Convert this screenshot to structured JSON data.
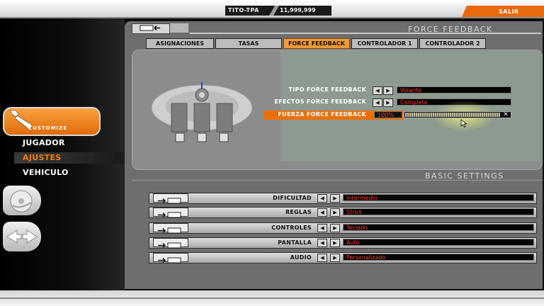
{
  "top_bar": {
    "player_name": "TITO-TPA",
    "money": "11,999,999",
    "exit_label": "SALIR"
  },
  "sidebar": {
    "customize_label": "CUSTOMIZE",
    "items": [
      {
        "label": "JUGADOR"
      },
      {
        "label": "AJUSTES",
        "active": true,
        "color": "#f07a10"
      },
      {
        "label": "VEHICULO"
      }
    ]
  },
  "panel": {
    "title": "FORCE FEEDBACK",
    "tabs": [
      {
        "label": "ASIGNACIONES"
      },
      {
        "label": "TASAS"
      },
      {
        "label": "FORCE FEEDBACK",
        "active": true
      },
      {
        "label": "CONTROLADOR 1"
      },
      {
        "label": "CONTROLADOR 2"
      }
    ]
  },
  "force_feedback": {
    "settings": [
      {
        "label": "TIPO FORCE FEEDBACK",
        "value": "Volante"
      },
      {
        "label": "EFECTOS FORCE FEEDBACK",
        "value": "Completo"
      },
      {
        "label": "FUERZA FORCE FEEDBACK",
        "value": "100%",
        "level": 1.0
      }
    ]
  },
  "basic_settings": {
    "title": "BASIC SETTINGS",
    "rows": [
      {
        "label": "DIFICULTAD",
        "value": "Intermedio"
      },
      {
        "label": "REGLAS",
        "value": "Strict"
      },
      {
        "label": "CONTROLES",
        "value": "Teclado"
      },
      {
        "label": "PANTALLA",
        "value": "Auto"
      },
      {
        "label": "AUDIO",
        "value": "Personalizado"
      }
    ]
  },
  "colors": {
    "accent_orange": "#f07a10",
    "value_red": "#ff3a2a",
    "panel_gray": "#6e6e6e"
  },
  "icons": [
    "wrench-icon",
    "back-arrow-icon",
    "disc-icon",
    "arrows-icon",
    "chevron-left-icon",
    "chevron-right-icon",
    "close-icon",
    "cockpit-diagram",
    "mouse-cursor-icon"
  ]
}
